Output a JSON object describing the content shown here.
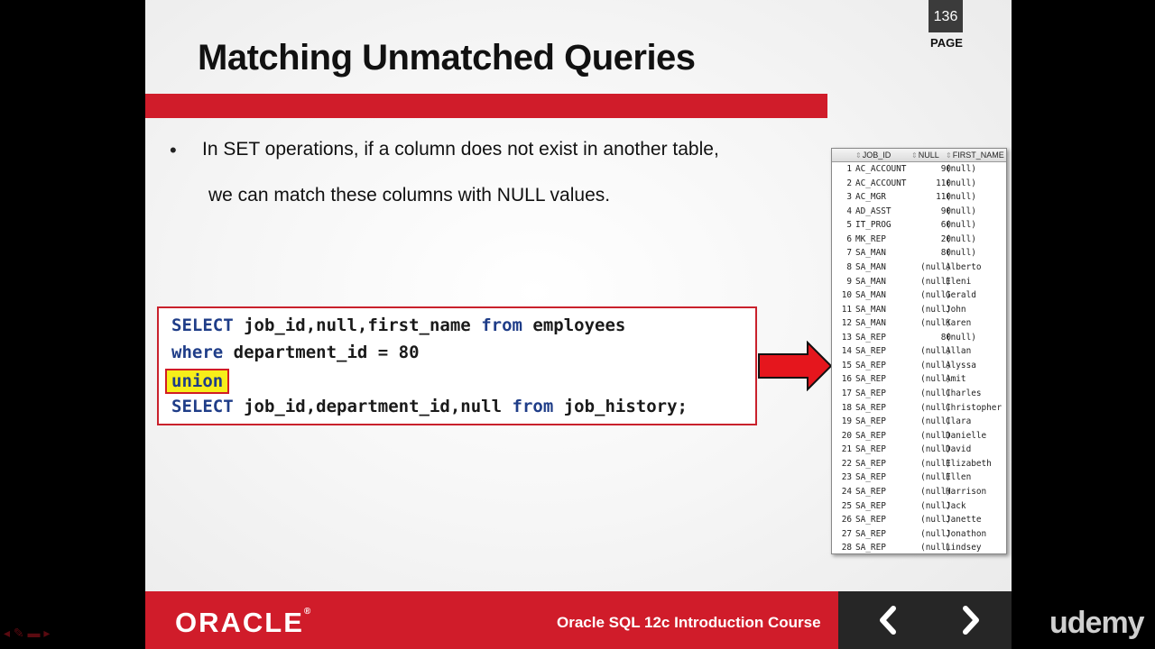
{
  "slide": {
    "title": "Matching Unmatched Queries",
    "page_number": "136",
    "page_label": "PAGE",
    "bullet": {
      "line1": "In SET operations,  if a column does not exist in another table,",
      "line2": "we can match these columns with NULL values."
    },
    "code": {
      "l1_kw1": "SELECT",
      "l1_rest1": " job_id,null,first_name ",
      "l1_kw2": "from",
      "l1_rest2": " employees",
      "l2_kw": "where",
      "l2_rest": " department_id = 80",
      "l3_union": "union",
      "l4_kw1": "SELECT",
      "l4_rest1": " job_id,department_id,null ",
      "l4_kw2": "from",
      "l4_rest2": " job_history;"
    },
    "result": {
      "headers": [
        "JOB_ID",
        "NULL",
        "FIRST_NAME"
      ],
      "rows": [
        [
          "1",
          "AC_ACCOUNT",
          "90",
          "(null)"
        ],
        [
          "2",
          "AC_ACCOUNT",
          "110",
          "(null)"
        ],
        [
          "3",
          "AC_MGR",
          "110",
          "(null)"
        ],
        [
          "4",
          "AD_ASST",
          "90",
          "(null)"
        ],
        [
          "5",
          "IT_PROG",
          "60",
          "(null)"
        ],
        [
          "6",
          "MK_REP",
          "20",
          "(null)"
        ],
        [
          "7",
          "SA_MAN",
          "80",
          "(null)"
        ],
        [
          "8",
          "SA_MAN",
          "(null)",
          "Alberto"
        ],
        [
          "9",
          "SA_MAN",
          "(null)",
          "Eleni"
        ],
        [
          "10",
          "SA_MAN",
          "(null)",
          "Gerald"
        ],
        [
          "11",
          "SA_MAN",
          "(null)",
          "John"
        ],
        [
          "12",
          "SA_MAN",
          "(null)",
          "Karen"
        ],
        [
          "13",
          "SA_REP",
          "80",
          "(null)"
        ],
        [
          "14",
          "SA_REP",
          "(null)",
          "Allan"
        ],
        [
          "15",
          "SA_REP",
          "(null)",
          "Alyssa"
        ],
        [
          "16",
          "SA_REP",
          "(null)",
          "Amit"
        ],
        [
          "17",
          "SA_REP",
          "(null)",
          "Charles"
        ],
        [
          "18",
          "SA_REP",
          "(null)",
          "Christopher"
        ],
        [
          "19",
          "SA_REP",
          "(null)",
          "Clara"
        ],
        [
          "20",
          "SA_REP",
          "(null)",
          "Danielle"
        ],
        [
          "21",
          "SA_REP",
          "(null)",
          "David"
        ],
        [
          "22",
          "SA_REP",
          "(null)",
          "Elizabeth"
        ],
        [
          "23",
          "SA_REP",
          "(null)",
          "Ellen"
        ],
        [
          "24",
          "SA_REP",
          "(null)",
          "Harrison"
        ],
        [
          "25",
          "SA_REP",
          "(null)",
          "Jack"
        ],
        [
          "26",
          "SA_REP",
          "(null)",
          "Janette"
        ],
        [
          "27",
          "SA_REP",
          "(null)",
          "Jonathon"
        ],
        [
          "28",
          "SA_REP",
          "(null)",
          "Lindsey"
        ]
      ]
    },
    "footer": {
      "logo": "ORACLE",
      "logo_reg": "®",
      "course": "Oracle SQL 12c Introduction Course"
    }
  },
  "brand": {
    "watermark": "udemy"
  },
  "icons": {
    "bullet": "•",
    "prev": "chevron-left-icon",
    "next": "chevron-right-icon",
    "arrow": "red-right-arrow-icon"
  },
  "colors": {
    "accent_red": "#d01c2a",
    "keyword_blue": "#1f3d88",
    "highlight_yellow": "#f6ee1a",
    "nav_dark": "#262626"
  }
}
